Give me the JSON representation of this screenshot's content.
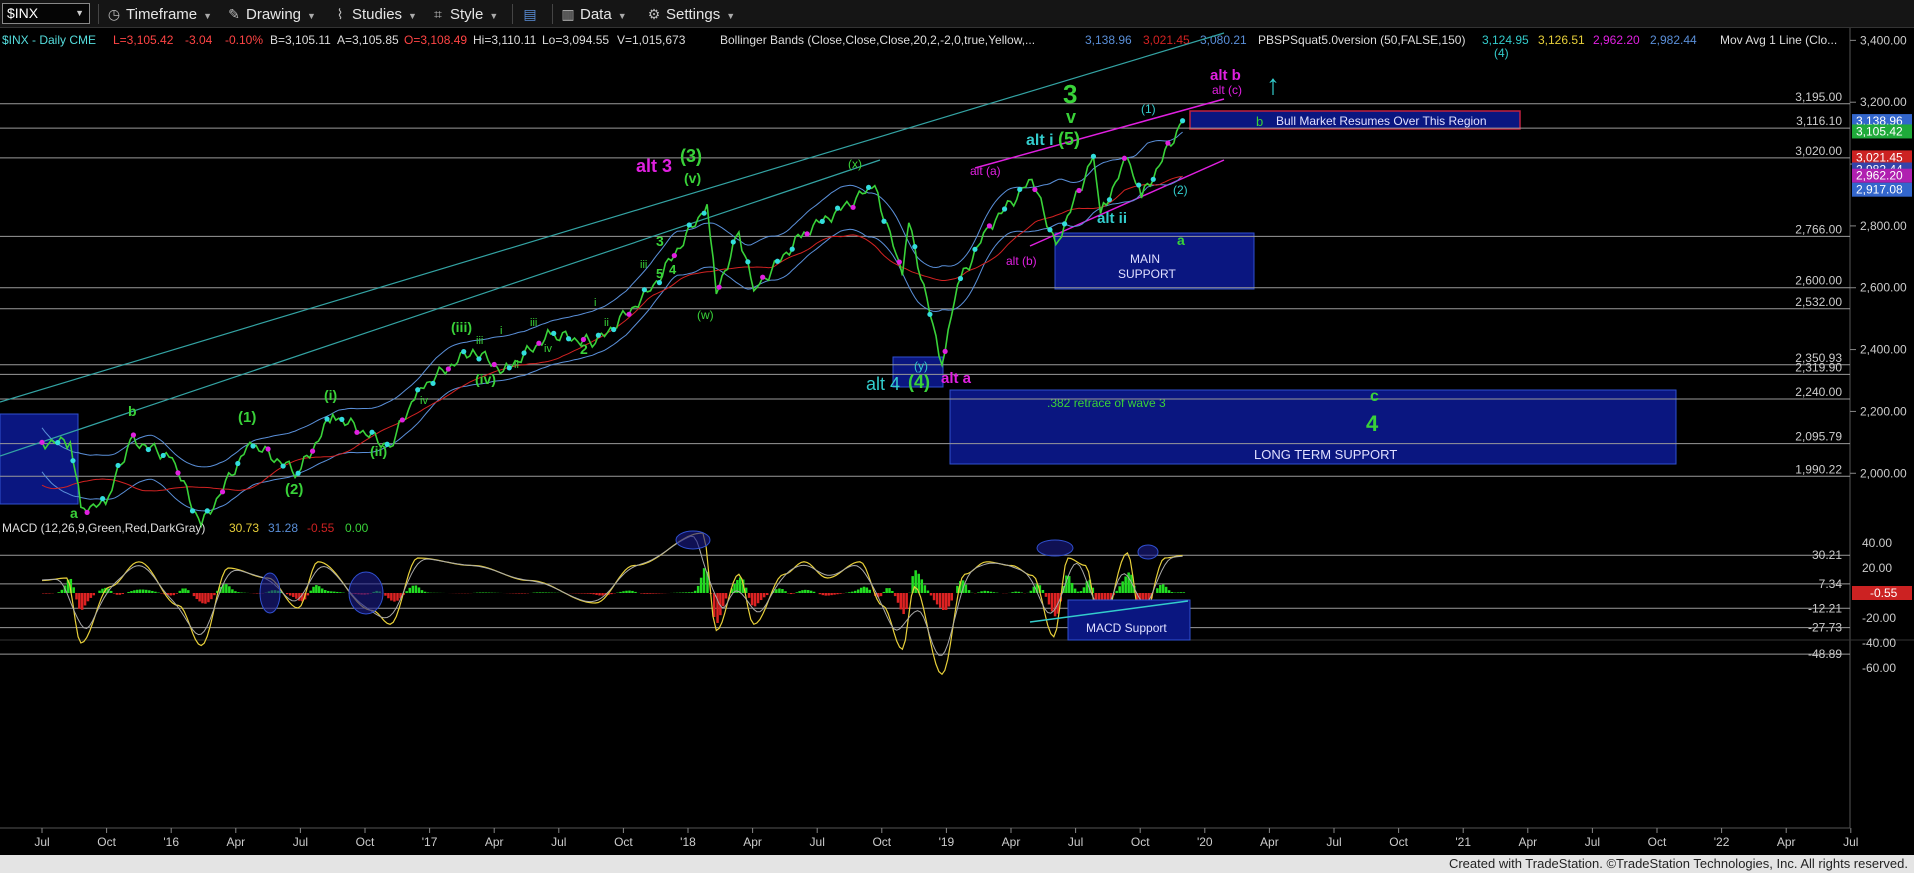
{
  "toolbar": {
    "symbol": "$INX",
    "timeframe_label": "Timeframe",
    "drawing_label": "Drawing",
    "studies_label": "Studies",
    "style_label": "Style",
    "data_label": "Data",
    "settings_label": "Settings"
  },
  "info_line": {
    "symbol_label": "$INX - Daily  CME",
    "last": "L=3,105.42",
    "change": "-3.04",
    "pct": "-0.10%",
    "bid": "B=3,105.11",
    "ask": "A=3,105.85",
    "open": "O=3,108.49",
    "high": "Hi=3,110.11",
    "low": "Lo=3,094.55",
    "volume": "V=1,015,673",
    "bb_label": "Bollinger Bands (Close,Close,Close,20,2,-2,0,true,Yellow,...",
    "bb_v1": "3,138.96",
    "bb_v2": "3,021.45",
    "bb_v3": "3,080.21",
    "pbs_label": "PBSPSquat5.0version (50,FALSE,150)",
    "pbs_v1": "3,124.95",
    "pbs_v2": "3,126.51",
    "pbs_v3": "2,962.20",
    "pbs_v4": "2,982.44",
    "ma_label": "Mov Avg 1 Line (Clo..."
  },
  "macd_line": {
    "label": "MACD (12,26,9,Green,Red,DarkGray)",
    "v1": "30.73",
    "v2": "31.28",
    "v3": "-0.55",
    "v4": "0.00"
  },
  "chart_data": {
    "type": "line",
    "title": "$INX - Daily",
    "x_ticks": [
      "Jul",
      "Oct",
      "'16",
      "Apr",
      "Jul",
      "Oct",
      "'17",
      "Apr",
      "Jul",
      "Oct",
      "'18",
      "Apr",
      "Jul",
      "Oct",
      "'19",
      "Apr",
      "Jul",
      "Oct",
      "'20",
      "Apr",
      "Jul",
      "Oct",
      "'21",
      "Apr",
      "Jul",
      "Oct",
      "'22",
      "Apr",
      "Jul"
    ],
    "price_axis_ticks": [
      "3,400.00",
      "3,200.00",
      "3,000.00",
      "2,800.00",
      "2,600.00",
      "2,400.00",
      "2,200.00",
      "2,000.00"
    ],
    "price_axis_values": [
      3400,
      3200,
      3000,
      2800,
      2600,
      2400,
      2200,
      2000
    ],
    "ylim": [
      1920,
      3440
    ],
    "grid": false,
    "horizontal_levels": [
      {
        "value": 3195.0,
        "label": "3,195.00"
      },
      {
        "value": 3116.1,
        "label": "3,116.10"
      },
      {
        "value": 3020.0,
        "label": "3,020.00"
      },
      {
        "value": 2766.0,
        "label": "2,766.00"
      },
      {
        "value": 2600.0,
        "label": "2,600.00"
      },
      {
        "value": 2532.0,
        "label": "2,532.00"
      },
      {
        "value": 2350.93,
        "label": "2,350.93"
      },
      {
        "value": 2319.9,
        "label": "2,319.90"
      },
      {
        "value": 2240.0,
        "label": "2,240.00"
      },
      {
        "value": 2095.79,
        "label": "2,095.79"
      },
      {
        "value": 1990.22,
        "label": "1,990.22"
      }
    ],
    "price_flags": [
      {
        "label": "3,138.96",
        "color": "#3366cc"
      },
      {
        "label": "3,105.42",
        "color": "#1faa3a"
      },
      {
        "label": "3,021.45",
        "color": "#cc2222"
      },
      {
        "label": "2,982.44",
        "color": "#3344aa"
      },
      {
        "label": "2,962.20",
        "color": "#b020b0"
      },
      {
        "label": "2,917.08",
        "color": "#3366cc"
      }
    ],
    "series": [
      {
        "name": "$INX",
        "x": [
          "2015-07-01",
          "2015-08-10",
          "2015-08-25",
          "2015-09-29",
          "2015-11-03",
          "2016-01-01",
          "2016-02-11",
          "2016-04-20",
          "2016-06-27",
          "2016-08-15",
          "2016-11-04",
          "2016-12-13",
          "2017-03-01",
          "2017-04-13",
          "2017-06-19",
          "2017-08-21",
          "2017-11-07",
          "2018-01-26",
          "2018-02-08",
          "2018-03-12",
          "2018-04-02",
          "2018-06-12",
          "2018-07-25",
          "2018-09-20",
          "2018-10-29",
          "2018-11-07",
          "2018-12-24",
          "2019-01-15",
          "2019-03-01",
          "2019-04-30",
          "2019-06-03",
          "2019-07-26",
          "2019-08-05",
          "2019-09-12",
          "2019-10-02",
          "2019-11-29"
        ],
        "values": [
          2100,
          2100,
          1890,
          1900,
          2110,
          2050,
          1830,
          2100,
          2000,
          2190,
          2085,
          2270,
          2400,
          2330,
          2450,
          2420,
          2590,
          2870,
          2580,
          2780,
          2590,
          2780,
          2840,
          2930,
          2640,
          2810,
          2350,
          2610,
          2800,
          2950,
          2740,
          3025,
          2840,
          3020,
          2890,
          3140
        ]
      }
    ],
    "macd": {
      "axis_ticks": [
        "40.00",
        "20.00",
        "0.00",
        "-20.00",
        "-40.00",
        "-60.00"
      ],
      "axis_values": [
        40,
        20,
        0,
        -20,
        -40,
        -60
      ],
      "ylim": [
        -68,
        52
      ],
      "levels": [
        {
          "value": 30.21,
          "label": "30.21"
        },
        {
          "value": 7.34,
          "label": "7.34"
        },
        {
          "value": -12.21,
          "label": "-12.21"
        },
        {
          "value": -27.73,
          "label": "-27.73"
        },
        {
          "value": -48.89,
          "label": "-48.89"
        }
      ],
      "current_flag": "-0.55",
      "x": [
        "2015-07-01",
        "2015-08-05",
        "2015-08-25",
        "2015-10-05",
        "2015-11-15",
        "2016-01-10",
        "2016-02-11",
        "2016-03-20",
        "2016-05-15",
        "2016-06-27",
        "2016-07-25",
        "2016-10-10",
        "2016-11-04",
        "2016-12-13",
        "2017-03-01",
        "2017-05-20",
        "2017-08-21",
        "2017-10-15",
        "2018-01-20",
        "2018-02-08",
        "2018-03-12",
        "2018-04-02",
        "2018-05-15",
        "2018-06-12",
        "2018-07-15",
        "2018-08-30",
        "2018-10-01",
        "2018-10-29",
        "2018-11-15",
        "2018-12-24",
        "2019-01-25",
        "2019-02-25",
        "2019-04-01",
        "2019-05-01",
        "2019-05-31",
        "2019-06-20",
        "2019-07-15",
        "2019-08-05",
        "2019-09-12",
        "2019-10-02",
        "2019-11-04",
        "2019-11-29"
      ],
      "values": [
        10,
        12,
        -40,
        5,
        25,
        -10,
        -42,
        20,
        12,
        -12,
        25,
        -14,
        -25,
        28,
        22,
        10,
        -8,
        22,
        48,
        -30,
        15,
        -25,
        15,
        25,
        12,
        25,
        -10,
        -45,
        5,
        -65,
        15,
        25,
        22,
        14,
        -35,
        28,
        22,
        -30,
        32,
        -25,
        28,
        30
      ]
    }
  },
  "annotations": {
    "alt_b": "alt b",
    "alt_c_paren": "alt (c)",
    "wave3_big": "3",
    "wave_v_green": "v",
    "alt_i_label": "alt i",
    "five_paren": "(5)",
    "alt_a_paren": "alt (a)",
    "alt_ii": "alt ii",
    "two_paren": "(2)",
    "one_paren": "(1)",
    "four_paren_top": "(4)",
    "b_label": "b",
    "bull_box": "Bull Market Resumes Over This Region",
    "a_label": "a",
    "main_support_1": "MAIN",
    "main_support_2": "SUPPORT",
    "alt_b_paren": "alt (b)",
    "alt3": "alt 3",
    "three_paren": "(3)",
    "v_paren": "(v)",
    "x_paren": "(x)",
    "w_paren": "(w)",
    "y_paren": "(y)",
    "four_paren_low": "(4)",
    "alt4": "alt 4",
    "alt_a": "alt a",
    "retrace_label": ".382 retrace of wave 3",
    "c_label": "c",
    "four_big": "4",
    "long_term": "LONG TERM SUPPORT",
    "small_3": "3",
    "small_5": "5",
    "small_4": "4",
    "small_iii": "iii",
    "iii_paren": "(iii)",
    "iv_paren": "(iv)",
    "i_paren": "(i)",
    "ii_paren": "(ii)",
    "one_paren_green": "(1)",
    "two_paren_green": "(2)",
    "b_green": "b",
    "a_green": "a",
    "two_green": "2",
    "i_small": "i",
    "ii_small": "ii",
    "iii_small": "iii",
    "iv_small": "iv",
    "iv_small2": "iv",
    "iii_small2": "iii",
    "i_small2": "i",
    "ii_small2": "ii",
    "macd_support": "MACD Support"
  },
  "colors": {
    "green": "#39d239",
    "magenta": "#e020e0",
    "cyan": "#33cccc",
    "box": "#0a1680",
    "line": "#aaaaaa"
  },
  "footer": "Created with TradeStation. ©TradeStation Technologies, Inc. All rights reserved."
}
